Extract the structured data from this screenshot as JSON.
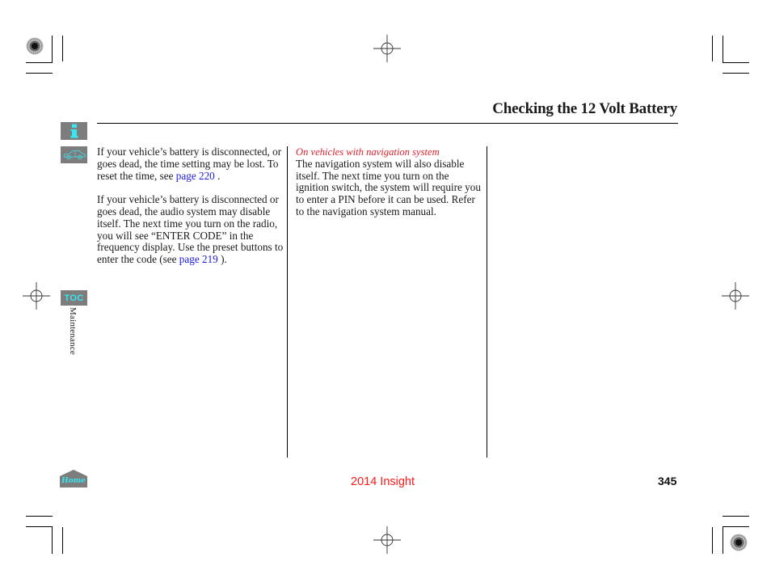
{
  "header": {
    "title": "Checking the 12 Volt Battery"
  },
  "sidebar": {
    "info_icon": "info-icon",
    "car_icon": "vehicle-icon",
    "toc_label": "TOC",
    "section_label": "Maintenance",
    "home_label": "Home"
  },
  "left_column": {
    "para1_text": "If your vehicle’s battery is disconnected, or goes dead, the time setting may be lost. To reset the time, see ",
    "para1_link": "page 220",
    "para1_end": " .",
    "para2_text": "If your vehicle’s battery is disconnected or goes dead, the audio system may disable itself. The next time you turn on the radio, you will see “ENTER CODE” in the frequency display. Use the preset buttons to enter the code (see ",
    "para2_link": "page 219",
    "para2_end": " )."
  },
  "middle_column": {
    "condition": "On vehicles with navigation system",
    "text": "The navigation system will also disable itself. The next time you turn on the ignition switch, the system will require you to enter a PIN before it can be used. Refer to the navigation system manual."
  },
  "footer": {
    "model": "2014 Insight",
    "page_number": "345"
  },
  "colors": {
    "link": "#1a1ae6",
    "condition": "#e21e2c",
    "model": "#ff1a1a",
    "sidebar_bg": "#7d7d7d",
    "sidebar_accent": "#37e6f0"
  }
}
